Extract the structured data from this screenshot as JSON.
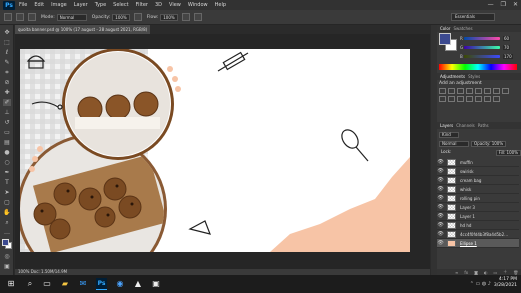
{
  "app": {
    "logo": "Ps"
  },
  "menu": [
    "File",
    "Edit",
    "Image",
    "Layer",
    "Type",
    "Select",
    "Filter",
    "3D",
    "View",
    "Window",
    "Help"
  ],
  "window_controls": [
    "—",
    "❐",
    "✕"
  ],
  "options": {
    "mode_label": "Mode:",
    "mode_value": "Normal",
    "opacity_label": "Opacity:",
    "opacity_value": "100%",
    "flow_label": "Flow:",
    "flow_value": "100%",
    "workspace": "Essentials"
  },
  "document": {
    "tab_title": "quoita banner.psd @ 100% (17 august - 28 august 2021, RGB/8)",
    "status": "100%      Doc: 1.50M/14.9M"
  },
  "color_panel": {
    "tabs": [
      "Color",
      "Swatches"
    ],
    "r": "60",
    "g": "70",
    "b": "170",
    "fg_color": "#3c4a90"
  },
  "adjustments": {
    "tabs": [
      "Adjustments",
      "Styles"
    ],
    "title": "Add an adjustment"
  },
  "layers_panel": {
    "tabs": [
      "Layers",
      "Channels",
      "Paths"
    ],
    "kind_label": "Kind",
    "blend": "Normal",
    "opacity": "Opacity: 100%",
    "fill": "Fill: 100%",
    "lock_label": "Lock:",
    "layers": [
      {
        "name": "muffin",
        "thumb": "check",
        "selected": false
      },
      {
        "name": "swirisk",
        "thumb": "check",
        "selected": false
      },
      {
        "name": "cream bag",
        "thumb": "check",
        "selected": false
      },
      {
        "name": "whisk",
        "thumb": "check",
        "selected": false
      },
      {
        "name": "rolling pin",
        "thumb": "check",
        "selected": false
      },
      {
        "name": "Layer 3",
        "thumb": "check",
        "selected": false
      },
      {
        "name": "Layer 1",
        "thumb": "check",
        "selected": false
      },
      {
        "name": "hd hd",
        "thumb": "check",
        "selected": false
      },
      {
        "name": "4cc4f0fd4b3f8a4d5b2…",
        "thumb": "check",
        "selected": false
      },
      {
        "name": "Ellipse 1",
        "thumb": "peach",
        "selected": true
      }
    ],
    "footer_icons": [
      "link-icon",
      "fx-icon",
      "mask-icon",
      "adjust-icon",
      "folder-icon",
      "new-layer-icon",
      "trash-icon"
    ]
  },
  "taskbar": {
    "time": "4:17 PM",
    "date": "3/28/2021",
    "ps_label": "Ps"
  }
}
